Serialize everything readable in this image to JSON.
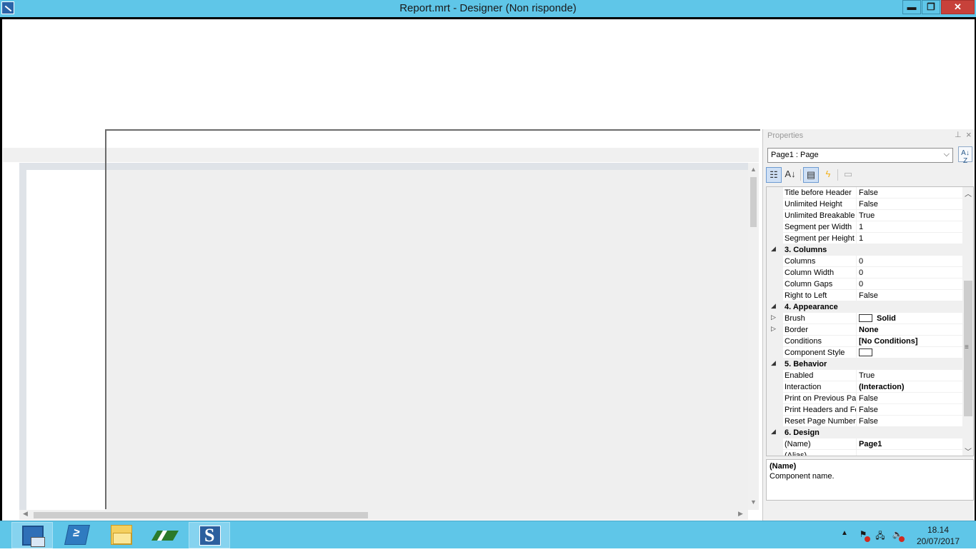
{
  "window": {
    "title": "Report.mrt - Designer (Non risponde)",
    "minimize": "▬",
    "maximize": "❐",
    "close": "✕"
  },
  "properties_panel": {
    "header": "Properties",
    "pin_glyph": "📌",
    "close_glyph": "×",
    "object_selector": "Page1 : Page",
    "rows": [
      {
        "type": "prop",
        "name": "Title before Header",
        "value": "False"
      },
      {
        "type": "prop",
        "name": "Unlimited Height",
        "value": "False"
      },
      {
        "type": "prop",
        "name": "Unlimited Breakable",
        "value": "True"
      },
      {
        "type": "prop",
        "name": "Segment per Width",
        "value": "1"
      },
      {
        "type": "prop",
        "name": "Segment per Height",
        "value": "1"
      },
      {
        "type": "category",
        "name": "3. Columns"
      },
      {
        "type": "prop",
        "name": "Columns",
        "value": "0"
      },
      {
        "type": "prop",
        "name": "Column Width",
        "value": "0"
      },
      {
        "type": "prop",
        "name": "Column Gaps",
        "value": "0"
      },
      {
        "type": "prop",
        "name": "Right to Left",
        "value": "False"
      },
      {
        "type": "category",
        "name": "4. Appearance"
      },
      {
        "type": "prop",
        "name": "Brush",
        "value": "Solid",
        "bold": true,
        "swatch": true,
        "expandable": true
      },
      {
        "type": "prop",
        "name": "Border",
        "value": "None",
        "bold": true,
        "expandable": true
      },
      {
        "type": "prop",
        "name": "Conditions",
        "value": "[No Conditions]",
        "bold": true
      },
      {
        "type": "prop",
        "name": "Component Style",
        "value": "",
        "swatch": true
      },
      {
        "type": "category",
        "name": "5. Behavior"
      },
      {
        "type": "prop",
        "name": "Enabled",
        "value": "True"
      },
      {
        "type": "prop",
        "name": "Interaction",
        "value": "(Interaction)",
        "bold": true
      },
      {
        "type": "prop",
        "name": "Print on Previous Pa",
        "value": "False"
      },
      {
        "type": "prop",
        "name": "Print Headers and Fo",
        "value": "False"
      },
      {
        "type": "prop",
        "name": "Reset Page Number",
        "value": "False"
      },
      {
        "type": "category",
        "name": "6. Design"
      },
      {
        "type": "prop",
        "name": "(Name)",
        "value": "Page1",
        "bold": true
      },
      {
        "type": "prop",
        "name": "(Alias)",
        "value": ""
      }
    ],
    "description": {
      "name": "(Name)",
      "text": "Component name."
    }
  },
  "taskbar": {
    "apps": [
      {
        "name": "Server Manager",
        "icon": "server-icon"
      },
      {
        "name": "Windows PowerShell",
        "icon": "powershell-icon"
      },
      {
        "name": "File Explorer",
        "icon": "folder-icon"
      },
      {
        "name": "GIS application",
        "icon": "gis-icon"
      },
      {
        "name": "Stimulsoft Designer",
        "icon": "stimulsoft-icon"
      }
    ],
    "clock": {
      "time": "18.14",
      "date": "20/07/2017"
    }
  }
}
